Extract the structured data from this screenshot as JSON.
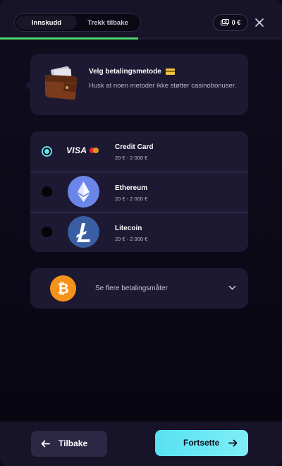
{
  "header": {
    "tabs": [
      {
        "label": "Innskudd",
        "active": true
      },
      {
        "label": "Trekk tilbake",
        "active": false
      }
    ],
    "balance": "0 €",
    "icons": {
      "balance": "cash-icon",
      "close": "close-icon"
    },
    "progress": 0.49
  },
  "info": {
    "title": "Velg betalingsmetode",
    "text": "Husk at noen metoder ikke støtter casinobonuser.",
    "icons": {
      "wallet": "wallet-icon",
      "card": "credit-card-emoji"
    }
  },
  "methods": [
    {
      "name": "Credit Card",
      "range": "20 € - 2 000 €",
      "selected": true,
      "logo": "visa-mastercard-logo",
      "logo_text": "VISA"
    },
    {
      "name": "Ethereum",
      "range": "20 € - 2 000 €",
      "selected": false,
      "logo": "ethereum-icon"
    },
    {
      "name": "Litecoin",
      "range": "20 € - 2 000 €",
      "selected": false,
      "logo": "litecoin-icon"
    }
  ],
  "more": {
    "label": "Se flere betalingsmåter",
    "icon": "bitcoin-icon"
  },
  "footer": {
    "back_label": "Tilbake",
    "next_label": "Fortsette"
  },
  "colors": {
    "accent": "#65e0ee",
    "progress": "#4cd46a",
    "card_bg": "#1d1933",
    "primary_button": "#58e1f2"
  }
}
